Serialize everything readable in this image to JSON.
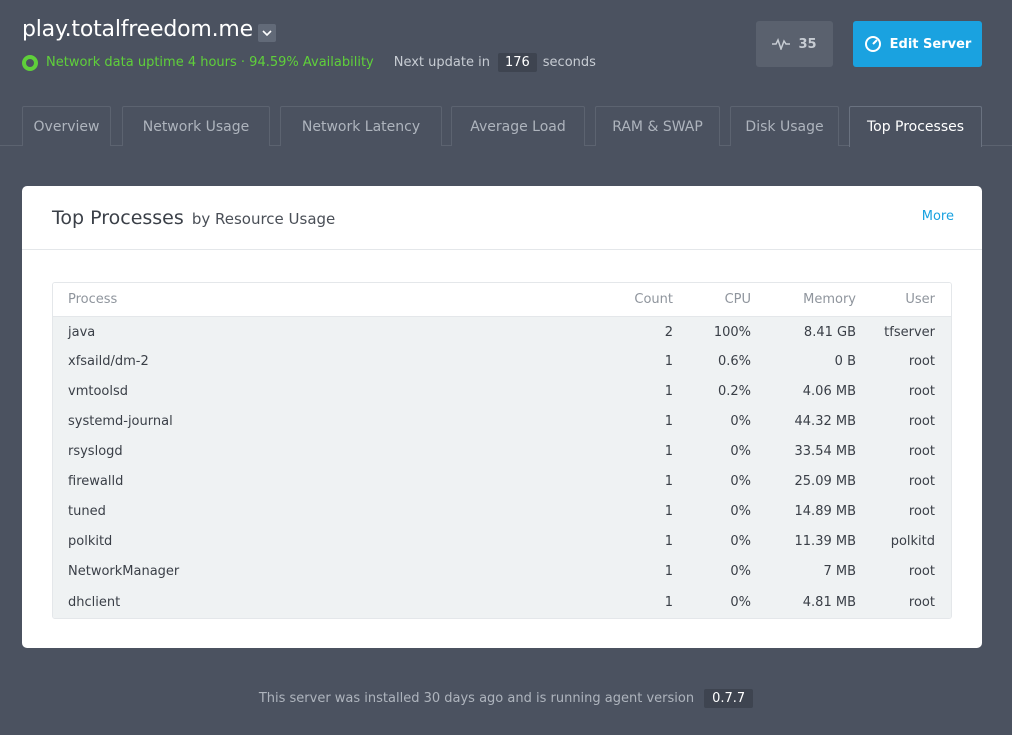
{
  "header": {
    "server_name": "play.totalfreedom.me",
    "uptime_text": "Network data uptime 4 hours · 94.59% Availability",
    "next_update_label": "Next update in",
    "countdown": "176",
    "seconds_label": "seconds",
    "activity_count": "35",
    "edit_label": "Edit Server",
    "colors": {
      "status": "#5fd03a",
      "accent": "#1aa2e0"
    }
  },
  "tabs": [
    {
      "label": "Overview"
    },
    {
      "label": "Network Usage"
    },
    {
      "label": "Network Latency"
    },
    {
      "label": "Average Load"
    },
    {
      "label": "RAM & SWAP"
    },
    {
      "label": "Disk Usage"
    },
    {
      "label": "Top Processes",
      "active": true
    }
  ],
  "card": {
    "title": "Top Processes",
    "subtitle": "by Resource Usage",
    "more_label": "More",
    "columns": [
      "Process",
      "Count",
      "CPU",
      "Memory",
      "User"
    ],
    "rows": [
      {
        "process": "java",
        "count": "2",
        "cpu": "100%",
        "memory": "8.41 GB",
        "user": "tfserver"
      },
      {
        "process": "xfsaild/dm-2",
        "count": "1",
        "cpu": "0.6%",
        "memory": "0 B",
        "user": "root"
      },
      {
        "process": "vmtoolsd",
        "count": "1",
        "cpu": "0.2%",
        "memory": "4.06 MB",
        "user": "root"
      },
      {
        "process": "systemd-journal",
        "count": "1",
        "cpu": "0%",
        "memory": "44.32 MB",
        "user": "root"
      },
      {
        "process": "rsyslogd",
        "count": "1",
        "cpu": "0%",
        "memory": "33.54 MB",
        "user": "root"
      },
      {
        "process": "firewalld",
        "count": "1",
        "cpu": "0%",
        "memory": "25.09 MB",
        "user": "root"
      },
      {
        "process": "tuned",
        "count": "1",
        "cpu": "0%",
        "memory": "14.89 MB",
        "user": "root"
      },
      {
        "process": "polkitd",
        "count": "1",
        "cpu": "0%",
        "memory": "11.39 MB",
        "user": "polkitd"
      },
      {
        "process": "NetworkManager",
        "count": "1",
        "cpu": "0%",
        "memory": "7 MB",
        "user": "root"
      },
      {
        "process": "dhclient",
        "count": "1",
        "cpu": "0%",
        "memory": "4.81 MB",
        "user": "root"
      }
    ]
  },
  "footer": {
    "text": "This server was installed 30 days ago and is running agent version",
    "version": "0.7.7"
  }
}
